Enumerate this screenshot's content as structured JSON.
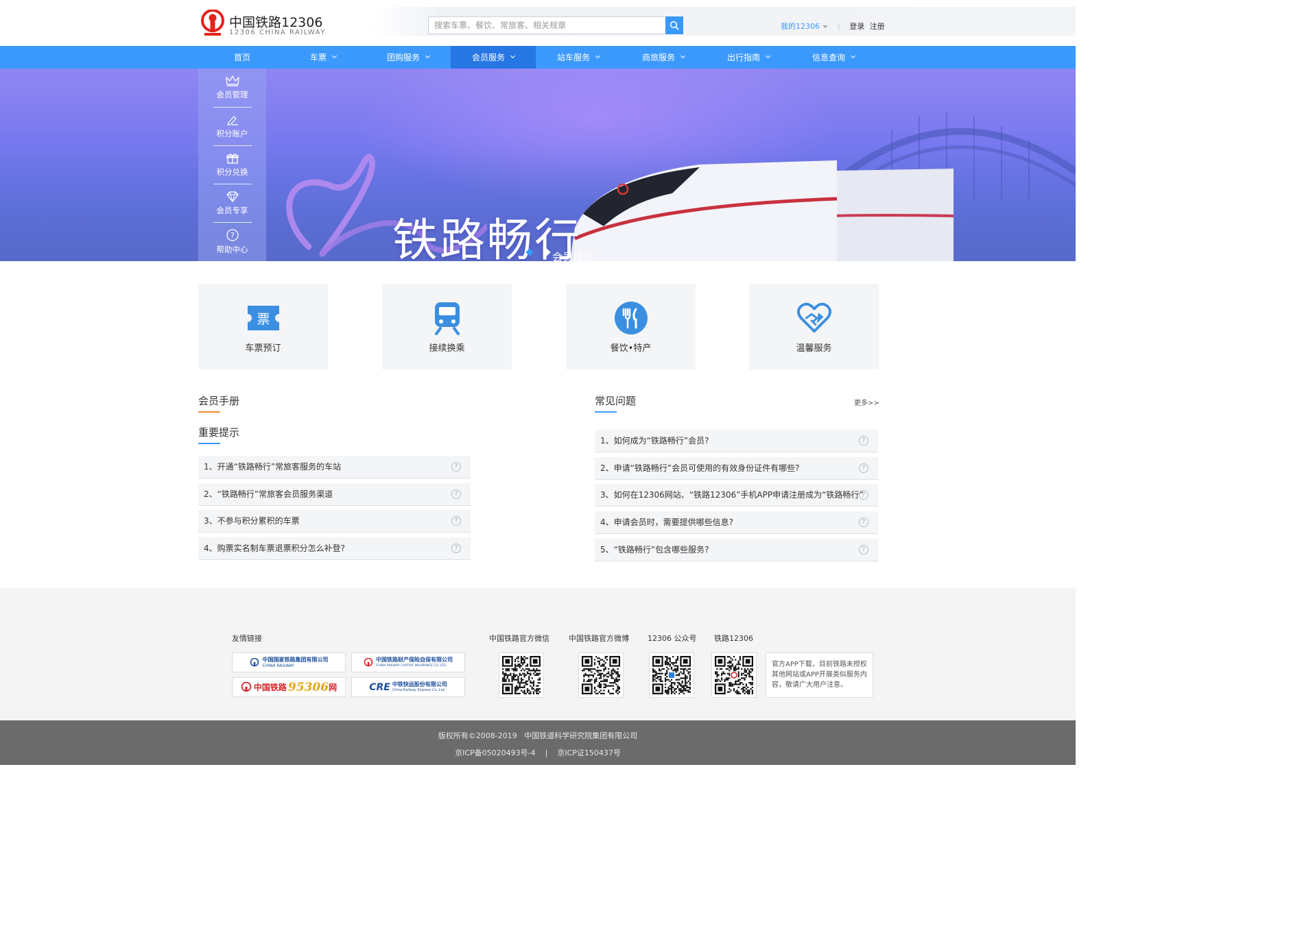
{
  "header": {
    "logo_title": "中国铁路12306",
    "logo_subtitle": "12306 CHINA RAILWAY",
    "search_placeholder": "搜索车票、餐饮、常旅客、相关规章",
    "my_12306": "我的12306",
    "login": "登录",
    "register": "注册"
  },
  "nav": {
    "items": [
      {
        "label": "首页"
      },
      {
        "label": "车票"
      },
      {
        "label": "团购服务"
      },
      {
        "label": "会员服务"
      },
      {
        "label": "站车服务"
      },
      {
        "label": "商旅服务"
      },
      {
        "label": "出行指南"
      },
      {
        "label": "信息查询"
      }
    ],
    "active": "会员服务"
  },
  "side_menu": {
    "items": [
      {
        "label": "会员管理",
        "icon": "crown-icon"
      },
      {
        "label": "积分账户",
        "icon": "pen-icon"
      },
      {
        "label": "积分兑换",
        "icon": "gift-icon"
      },
      {
        "label": "会员专享",
        "icon": "diamond-icon"
      },
      {
        "label": "帮助中心",
        "icon": "question-icon"
      }
    ]
  },
  "banner": {
    "title": "铁路畅行",
    "subtitle": "会员计划",
    "slides_total": 2,
    "active_slide": 1
  },
  "services": {
    "items": [
      {
        "label": "车票预订",
        "icon": "ticket-icon",
        "icon_text": "票"
      },
      {
        "label": "接续换乘",
        "icon": "train-icon"
      },
      {
        "label": "餐饮•特产",
        "icon": "dining-icon"
      },
      {
        "label": "温馨服务",
        "icon": "handshake-heart-icon"
      }
    ]
  },
  "handbook": {
    "title": "会员手册",
    "notice_title": "重要提示",
    "items": [
      "1、开通“铁路畅行”常旅客服务的车站",
      "2、“铁路畅行”常旅客会员服务渠道",
      "3、不参与积分累积的车票",
      "4、购票实名制车票退票积分怎么补登?"
    ]
  },
  "faq": {
    "title": "常见问题",
    "more": "更多>>",
    "items": [
      "1、如何成为“铁路畅行”会员?",
      "2、申请“铁路畅行”会员可使用的有效身份证件有哪些?",
      "3、如何在12306网站、“铁路12306”手机APP申请注册成为“铁路畅行”",
      "4、申请会员时，需要提供哪些信息?",
      "5、“铁路畅行”包含哪些服务?"
    ]
  },
  "footer": {
    "links_title": "友情链接",
    "partners": [
      {
        "name": "中国国家铁路集团有限公司",
        "sub": "CHINA RAILWAY"
      },
      {
        "name": "中国铁路财产保险自保有限公司",
        "sub": "CHINA RAILWAY CAPTIVE INSURANCE CO.,LTD."
      },
      {
        "name": "中国铁路",
        "accent": "95306",
        "suffix": "网"
      },
      {
        "name": "CRE",
        "accent": "中铁快运股份有限公司",
        "sub": "China Railway Express Co.,Ltd."
      }
    ],
    "qr_titles": [
      "中国铁路官方微信",
      "中国铁路官方微博",
      "12306 公众号",
      "铁路12306"
    ],
    "notice": "官方APP下载，目前铁路未授权其他网站或APP开展类似服务内容，敬请广大用户注意。",
    "copyright": "版权所有©2008-2019   中国铁道科学研究院集团有限公司",
    "icp1": "京ICP备05020493号-4",
    "icp_sep": "|",
    "icp2": "京ICP证150437号"
  },
  "colors": {
    "brand_blue": "#3b99fc",
    "nav_active": "#2676e3",
    "logo_red": "#e2231a",
    "handbook_accent": "#f08c2e",
    "faq_accent": "#3b99fc"
  }
}
